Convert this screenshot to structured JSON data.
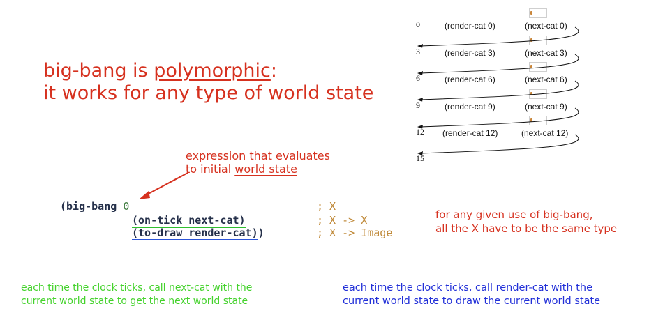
{
  "title": {
    "prefix": "big-bang is ",
    "underlined": "polymorphic",
    "suffix": ":",
    "line2": "it works for any type of world state"
  },
  "annotation": {
    "line1": "expression that evaluates",
    "line2_prefix": "to initial ",
    "line2_underlined": "world state"
  },
  "code": {
    "line1_head": "(big-bang ",
    "line1_arg": "0",
    "line2": "(on-tick next-cat)",
    "line3_inner": "(to-draw render-cat)",
    "line3_tail": ")"
  },
  "comments": {
    "c1": "; X",
    "c2": "; X -> X",
    "c3": "; X -> Image"
  },
  "note": {
    "line1": "for any given use of big-bang,",
    "line2": "all the X have to be the same type"
  },
  "bottom_left": {
    "line1": "each time the clock ticks, call next-cat with the",
    "line2": "current world state to get the next world state"
  },
  "bottom_right": {
    "line1": "each time the clock ticks, call render-cat with the",
    "line2": "current world state to draw the current world state"
  },
  "diagram": {
    "rows": [
      {
        "state": "0",
        "render": "(render-cat 0)",
        "next": "(next-cat 0)"
      },
      {
        "state": "3",
        "render": "(render-cat 3)",
        "next": "(next-cat 3)"
      },
      {
        "state": "6",
        "render": "(render-cat 6)",
        "next": "(next-cat 6)"
      },
      {
        "state": "9",
        "render": "(render-cat 9)",
        "next": "(next-cat 9)"
      },
      {
        "state": "12",
        "render": "(render-cat 12)",
        "next": "(next-cat 12)"
      }
    ],
    "final_state": "15"
  },
  "colors": {
    "red": "#d6311f",
    "green": "#44d22c",
    "blue": "#2230d8",
    "comment": "#c08a3a"
  }
}
